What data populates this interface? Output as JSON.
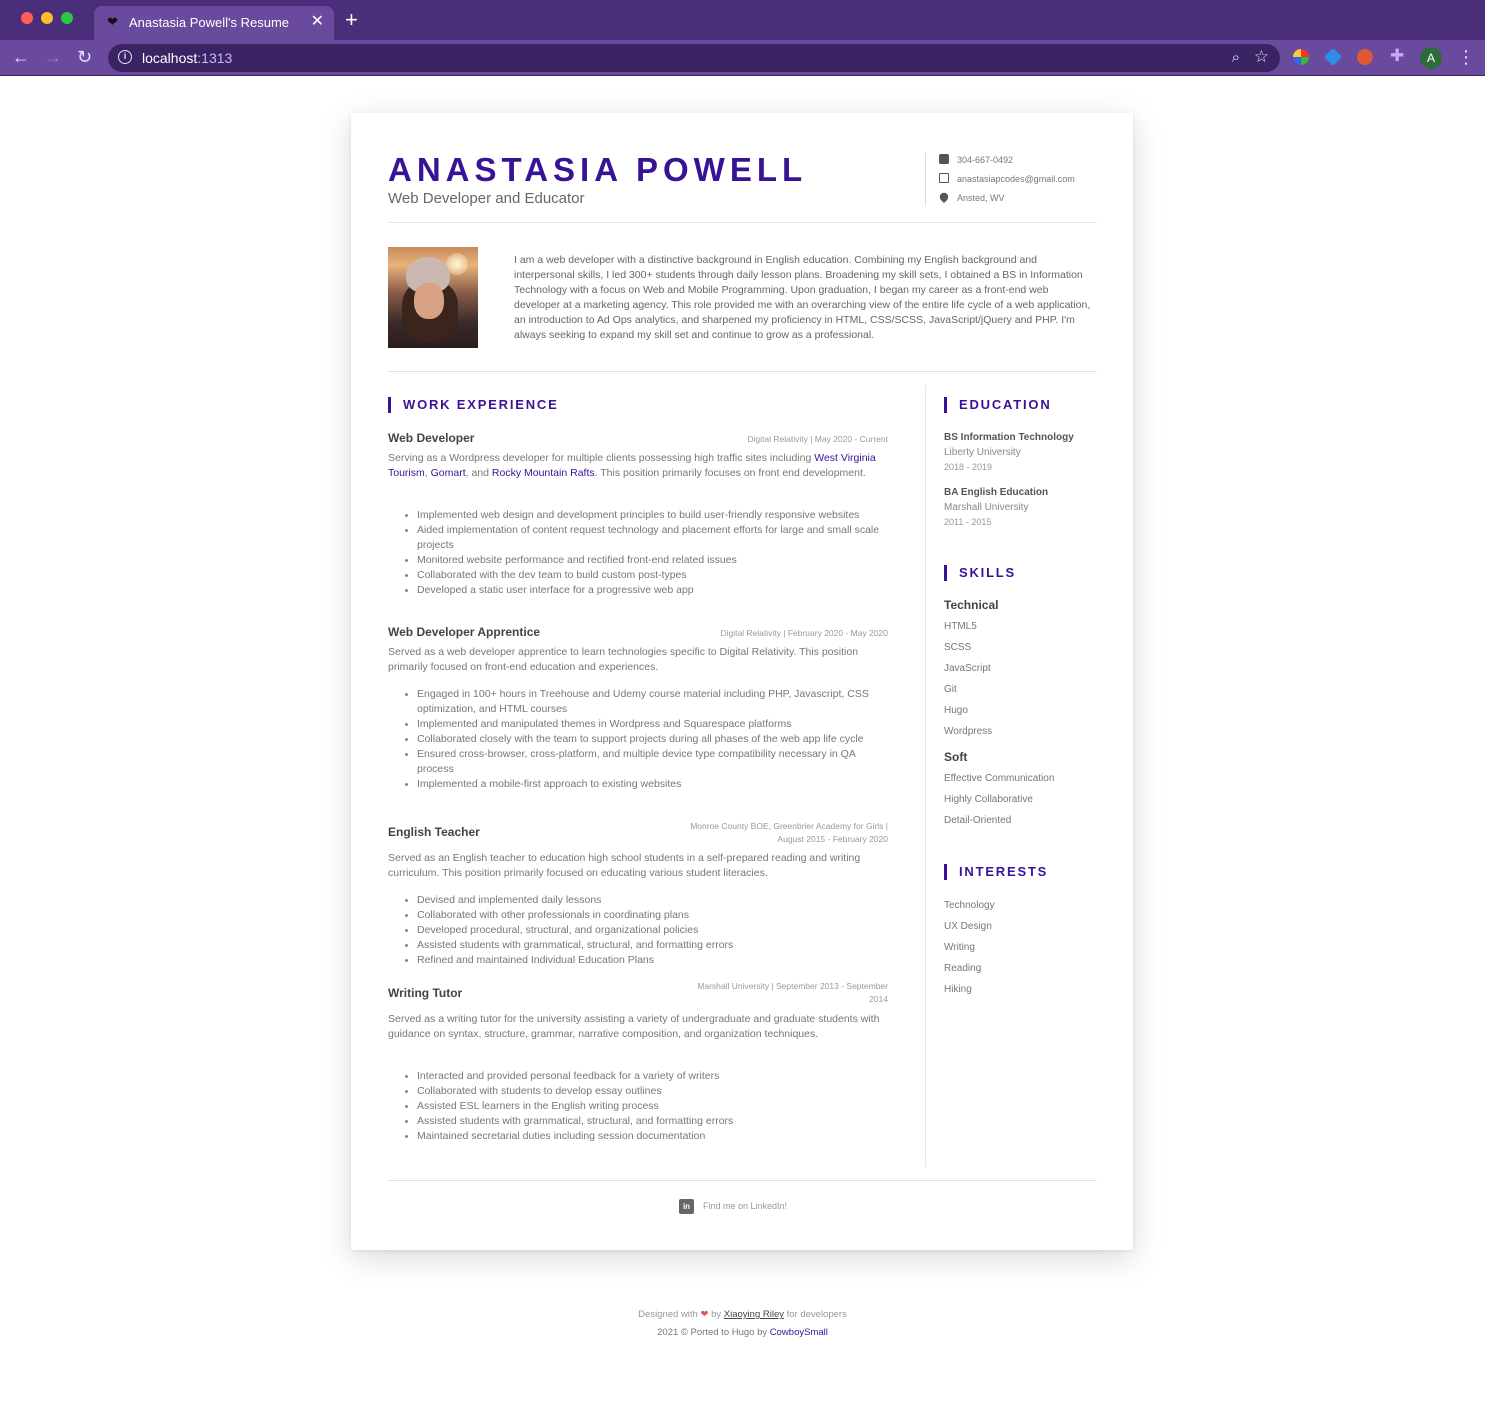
{
  "browser": {
    "tab_title": "Anastasia Powell's Resume",
    "tab_icon": "heart-icon",
    "url_host": "localhost",
    "url_port": ":1313",
    "profile_initial": "A"
  },
  "header": {
    "name": "ANASTASIA POWELL",
    "role": "Web Developer and Educator",
    "phone": "304-667-0492",
    "email": "anastasiapcodes@gmail.com",
    "location": "Ansted, WV"
  },
  "bio": "I am a web developer with a distinctive background in English education. Combining my English background and interpersonal skills, I led 300+ students through daily lesson plans. Broadening my skill sets, I obtained a BS in Information Technology with a focus on Web and Mobile Programming. Upon graduation, I began my career as a front-end web developer at a marketing agency. This role provided me with an overarching view of the entire life cycle of a web application, an introduction to Ad Ops analytics, and sharpened my proficiency in HTML, CSS/SCSS, JavaScript/jQuery and PHP. I'm always seeking to expand my skill set and continue to grow as a professional.",
  "work": {
    "heading": "WORK EXPERIENCE",
    "jobs": [
      {
        "title": "Web Developer",
        "meta": "Digital Relativity | May 2020 - Current",
        "desc_pre": "Serving as a Wordpress developer for multiple clients possessing high traffic sites including ",
        "link1": "West Virginia Tourism",
        "sep1": ", ",
        "link2": "Gomart",
        "sep2": ", and ",
        "link3": "Rocky Mountain Rafts",
        "desc_post": ". This position primarily focuses on front end development.",
        "bullets": [
          "Implemented web design and development principles to build user-friendly responsive websites",
          "Aided implementation of content request technology and placement efforts for large and small scale projects",
          "Monitored website performance and rectified front-end related issues",
          "Collaborated with the dev team to build custom post-types",
          "Developed a static user interface for a progressive web app"
        ]
      },
      {
        "title": "Web Developer Apprentice",
        "meta": "Digital Relativity | February 2020 - May 2020",
        "desc": "Served as a web developer apprentice to learn technologies specific to Digital Relativity. This position primarily focused on front-end education and experiences.",
        "bullets": [
          "Engaged in 100+ hours in Treehouse and Udemy course material including PHP, Javascript, CSS optimization, and HTML courses",
          "Implemented and manipulated themes in Wordpress and Squarespace platforms",
          "Collaborated closely with the team to support projects during all phases of the web app life cycle",
          "Ensured cross-browser, cross-platform, and multiple device type compatibility necessary in QA process",
          "Implemented a mobile-first approach to existing websites"
        ]
      },
      {
        "title": "English Teacher",
        "meta_line1": "Monroe County BOE, Greenbrier Academy for Girls |",
        "meta_line2": "August 2015 - February 2020",
        "desc": "Served as an English teacher to education high school students in a self-prepared reading and writing curriculum. This position primarily focused on educating various student literacies.",
        "bullets": [
          "Devised and implemented daily lessons",
          "Collaborated with other professionals in coordinating plans",
          "Developed procedural, structural, and organizational policies",
          "Assisted students with grammatical, structural, and formatting errors",
          "Refined and maintained Individual Education Plans"
        ]
      },
      {
        "title": "Writing Tutor",
        "meta_line1": "Marshall University | September 2013 - September",
        "meta_line2": "2014",
        "desc": "Served as a writing tutor for the university assisting a variety of undergraduate and graduate students with guidance on syntax, structure, grammar, narrative composition, and organization techniques.",
        "bullets": [
          "Interacted and provided personal feedback for a variety of writers",
          "Collaborated with students to develop essay outlines",
          "Assisted ESL learners in the English writing process",
          "Assisted students with grammatical, structural, and formatting errors",
          "Maintained secretarial duties including session documentation"
        ]
      }
    ]
  },
  "education": {
    "heading": "EDUCATION",
    "items": [
      {
        "degree": "BS Information Technology",
        "school": "Liberty University",
        "years": "2018 - 2019"
      },
      {
        "degree": "BA English Education",
        "school": "Marshall University",
        "years": "2011 - 2015"
      }
    ]
  },
  "skills": {
    "heading": "SKILLS",
    "technical_label": "Technical",
    "technical": [
      "HTML5",
      "SCSS",
      "JavaScript",
      "Git",
      "Hugo",
      "Wordpress"
    ],
    "soft_label": "Soft",
    "soft": [
      "Effective Communication",
      "Highly Collaborative",
      "Detail-Oriented"
    ]
  },
  "interests": {
    "heading": "INTERESTS",
    "items": [
      "Technology",
      "UX Design",
      "Writing",
      "Reading",
      "Hiking"
    ]
  },
  "linkedin": {
    "text": "Find me on LinkedIn!",
    "icon": "linkedin-icon",
    "icon_text": "in"
  },
  "footer": {
    "line1_pre": "Designed with",
    "heart": "❤",
    "line1_by": "by",
    "author": "Xiaoying Riley",
    "line1_post": "for developers",
    "line2_pre": "2021 © Ported to Hugo by",
    "porter": "CowboySmall"
  },
  "colors": {
    "accent": "#3a1296",
    "chrome": "#4a2e7a",
    "tab": "#6a4a9c"
  }
}
